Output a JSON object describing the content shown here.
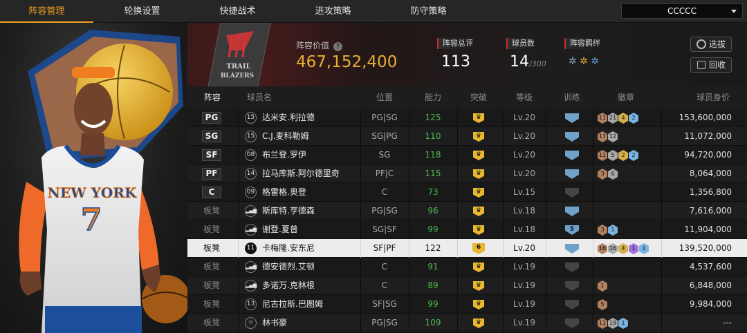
{
  "nav": {
    "tabs": [
      "阵容管理",
      "轮换设置",
      "快捷战术",
      "进攻策略",
      "防守策略"
    ],
    "active": 0,
    "selector_value": "CCCCC"
  },
  "header": {
    "team_logo_text": "TRAIL BLAZERS",
    "value_label": "阵容价值",
    "value": "467,152,400",
    "rating_label": "阵容总评",
    "rating": "113",
    "players_label": "球员数",
    "players_count": "14",
    "players_max": "/300",
    "chem_label": "阵容羁绊",
    "pick_button": "选拔",
    "recycle_button": "回收",
    "colors": {
      "accent": "#f0a020",
      "gold": "#e8b030",
      "red_marker": "#c72b2b"
    }
  },
  "table": {
    "headers": [
      "阵容",
      "球员名",
      "位置",
      "能力",
      "突破",
      "等级",
      "训练",
      "徽章",
      "球员身价"
    ],
    "rows": [
      {
        "slot": "PG",
        "starter": true,
        "jersey": "15",
        "name": "达米安.利拉德",
        "pos": "PG|SG",
        "ability": "125",
        "breakthrough": "crown",
        "level": "Lv.20",
        "training": "blue",
        "training_text": "",
        "badges": [
          [
            "11",
            "b1"
          ],
          [
            "21",
            "b2"
          ],
          [
            "4",
            "b3"
          ],
          [
            "2",
            "b4"
          ]
        ],
        "value": "153,600,000"
      },
      {
        "slot": "SG",
        "starter": true,
        "jersey": "15",
        "name": "C.J.麦科勒姆",
        "pos": "SG|PG",
        "ability": "110",
        "breakthrough": "crown",
        "level": "Lv.20",
        "training": "blue",
        "training_text": "",
        "badges": [
          [
            "17",
            "b1"
          ],
          [
            "12",
            "b2"
          ]
        ],
        "value": "11,072,000"
      },
      {
        "slot": "SF",
        "starter": true,
        "jersey": "08",
        "name": "布兰登.罗伊",
        "pos": "SG",
        "ability": "118",
        "breakthrough": "crown",
        "level": "Lv.20",
        "training": "blue",
        "training_text": "",
        "badges": [
          [
            "11",
            "b1"
          ],
          [
            "5",
            "b2"
          ],
          [
            "2",
            "b3"
          ],
          [
            "2",
            "b4"
          ]
        ],
        "value": "94,720,000"
      },
      {
        "slot": "PF",
        "starter": true,
        "jersey": "14",
        "name": "拉马库斯.阿尔德里奇",
        "pos": "PF|C",
        "ability": "115",
        "breakthrough": "crown",
        "level": "Lv.20",
        "training": "blue",
        "training_text": "",
        "badges": [
          [
            "3",
            "b1"
          ],
          [
            "6",
            "b2"
          ]
        ],
        "value": "8,064,000"
      },
      {
        "slot": "C",
        "starter": true,
        "jersey": "09",
        "name": "格雷格.奥登",
        "pos": "C",
        "ability": "73",
        "breakthrough": "crown",
        "level": "Lv.15",
        "training": "grey",
        "training_text": "",
        "badges": [],
        "value": "1,356,800"
      },
      {
        "slot": "板凳",
        "starter": false,
        "jersey": "bars",
        "name": "斯库特.亨德森",
        "pos": "PG|SG",
        "ability": "96",
        "breakthrough": "crown",
        "level": "Lv.18",
        "training": "blue",
        "training_text": "",
        "badges": [],
        "value": "7,616,000"
      },
      {
        "slot": "板凳",
        "starter": false,
        "jersey": "bars",
        "name": "谢登.夏普",
        "pos": "SG|SF",
        "ability": "99",
        "breakthrough": "crown",
        "level": "Lv.18",
        "training": "blue",
        "training_text": "5",
        "badges": [
          [
            "3",
            "b1"
          ],
          [
            "1",
            "b4"
          ]
        ],
        "value": "11,904,000"
      },
      {
        "slot": "板凳",
        "starter": false,
        "jersey": "11",
        "name": "卡梅隆.安东尼",
        "pos": "SF|PF",
        "ability": "122",
        "breakthrough": "6",
        "level": "Lv.20",
        "training": "blue",
        "training_text": "",
        "badges": [
          [
            "16",
            "b1"
          ],
          [
            "16",
            "b2"
          ],
          [
            "4",
            "b3"
          ],
          [
            "1",
            "b5"
          ],
          [
            "1",
            "b4"
          ]
        ],
        "value": "139,520,000",
        "selected": true
      },
      {
        "slot": "板凳",
        "starter": false,
        "jersey": "bars",
        "name": "德安德烈.艾顿",
        "pos": "C",
        "ability": "91",
        "breakthrough": "crown",
        "level": "Lv.19",
        "training": "grey",
        "training_text": "",
        "badges": [],
        "value": "4,537,600"
      },
      {
        "slot": "板凳",
        "starter": false,
        "jersey": "bars",
        "name": "多诺万.克林根",
        "pos": "C",
        "ability": "89",
        "breakthrough": "crown",
        "level": "Lv.19",
        "training": "grey",
        "training_text": "",
        "badges": [
          [
            "1",
            "b1"
          ]
        ],
        "value": "6,848,000"
      },
      {
        "slot": "板凳",
        "starter": false,
        "jersey": "13",
        "name": "尼古拉斯.巴图姆",
        "pos": "SF|SG",
        "ability": "99",
        "breakthrough": "crown",
        "level": "Lv.19",
        "training": "grey",
        "training_text": "",
        "badges": [
          [
            "5",
            "b1"
          ]
        ],
        "value": "9,984,000"
      },
      {
        "slot": "板凳",
        "starter": false,
        "jersey": "star",
        "name": "林书豪",
        "pos": "PG|SG",
        "ability": "109",
        "breakthrough": "crown",
        "level": "Lv.19",
        "training": "grey",
        "training_text": "",
        "badges": [
          [
            "11",
            "b1"
          ],
          [
            "19",
            "b2"
          ],
          [
            "1",
            "b4"
          ]
        ],
        "value": "---"
      }
    ]
  }
}
